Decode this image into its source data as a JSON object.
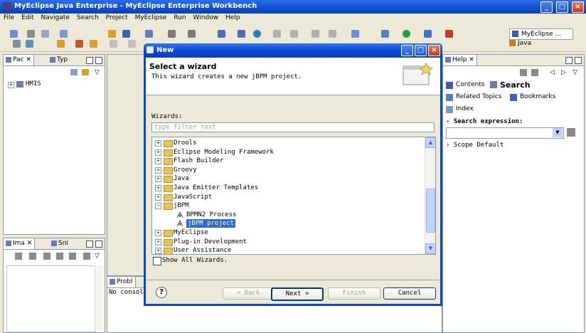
{
  "window": {
    "title": "MyEclipse Java Enterprise - MyEclipse Enterprise Workbench",
    "controls": [
      "_",
      "□",
      "×"
    ]
  },
  "menu": [
    "File",
    "Edit",
    "Navigate",
    "Search",
    "Project",
    "MyEclipse",
    "Run",
    "Window",
    "Help"
  ],
  "perspectives": {
    "myeclipse": "MyEclipse ...",
    "java": "Java"
  },
  "left_top_view": {
    "tabs": [
      "Pac",
      "Typ"
    ],
    "tree": [
      "HMIS"
    ]
  },
  "left_bottom_view": {
    "tabs": [
      "Ima",
      "Sni"
    ]
  },
  "bottom_view": {
    "tab": "Probl",
    "content": "No consol"
  },
  "right_view": {
    "tab": "Help",
    "links": [
      "Contents",
      "Search",
      "Related Topics",
      "Bookmarks",
      "Index"
    ],
    "search_label": "Search expression:",
    "scope": "Scope Default"
  },
  "dialog": {
    "title": "New",
    "heading": "Select a wizard",
    "description": "This wizard creates a new jBPM project.",
    "wizards_label": "Wizards:",
    "filter_placeholder": "type filter text",
    "tree": [
      {
        "label": "Drools",
        "level": 0,
        "type": "folder",
        "expanded": false
      },
      {
        "label": "Eclipse Modeling Framework",
        "level": 0,
        "type": "folder",
        "expanded": false
      },
      {
        "label": "Flash Builder",
        "level": 0,
        "type": "folder",
        "expanded": false
      },
      {
        "label": "Groovy",
        "level": 0,
        "type": "folder",
        "expanded": false
      },
      {
        "label": "Java",
        "level": 0,
        "type": "folder",
        "expanded": false
      },
      {
        "label": "Java Emitter Templates",
        "level": 0,
        "type": "folder",
        "expanded": false
      },
      {
        "label": "JavaScript",
        "level": 0,
        "type": "folder",
        "expanded": false
      },
      {
        "label": "jBPM",
        "level": 0,
        "type": "folder",
        "expanded": true
      },
      {
        "label": "BPMN2 Process",
        "level": 1,
        "type": "item",
        "selected": false
      },
      {
        "label": "jBPM project",
        "level": 1,
        "type": "item",
        "selected": true
      },
      {
        "label": "MyEclipse",
        "level": 0,
        "type": "folder",
        "expanded": false
      },
      {
        "label": "Plug-in Development",
        "level": 0,
        "type": "folder",
        "expanded": false
      },
      {
        "label": "User Assistance",
        "level": 0,
        "type": "folder",
        "expanded": false
      }
    ],
    "show_all_label": "Show All Wizards.",
    "buttons": {
      "back": "< Back",
      "next": "Next >",
      "finish": "Finish",
      "cancel": "Cancel"
    }
  },
  "colors": {
    "titlebar": "#0f4fd2",
    "selection": "#316ac5",
    "folder": "#e8c25a"
  }
}
